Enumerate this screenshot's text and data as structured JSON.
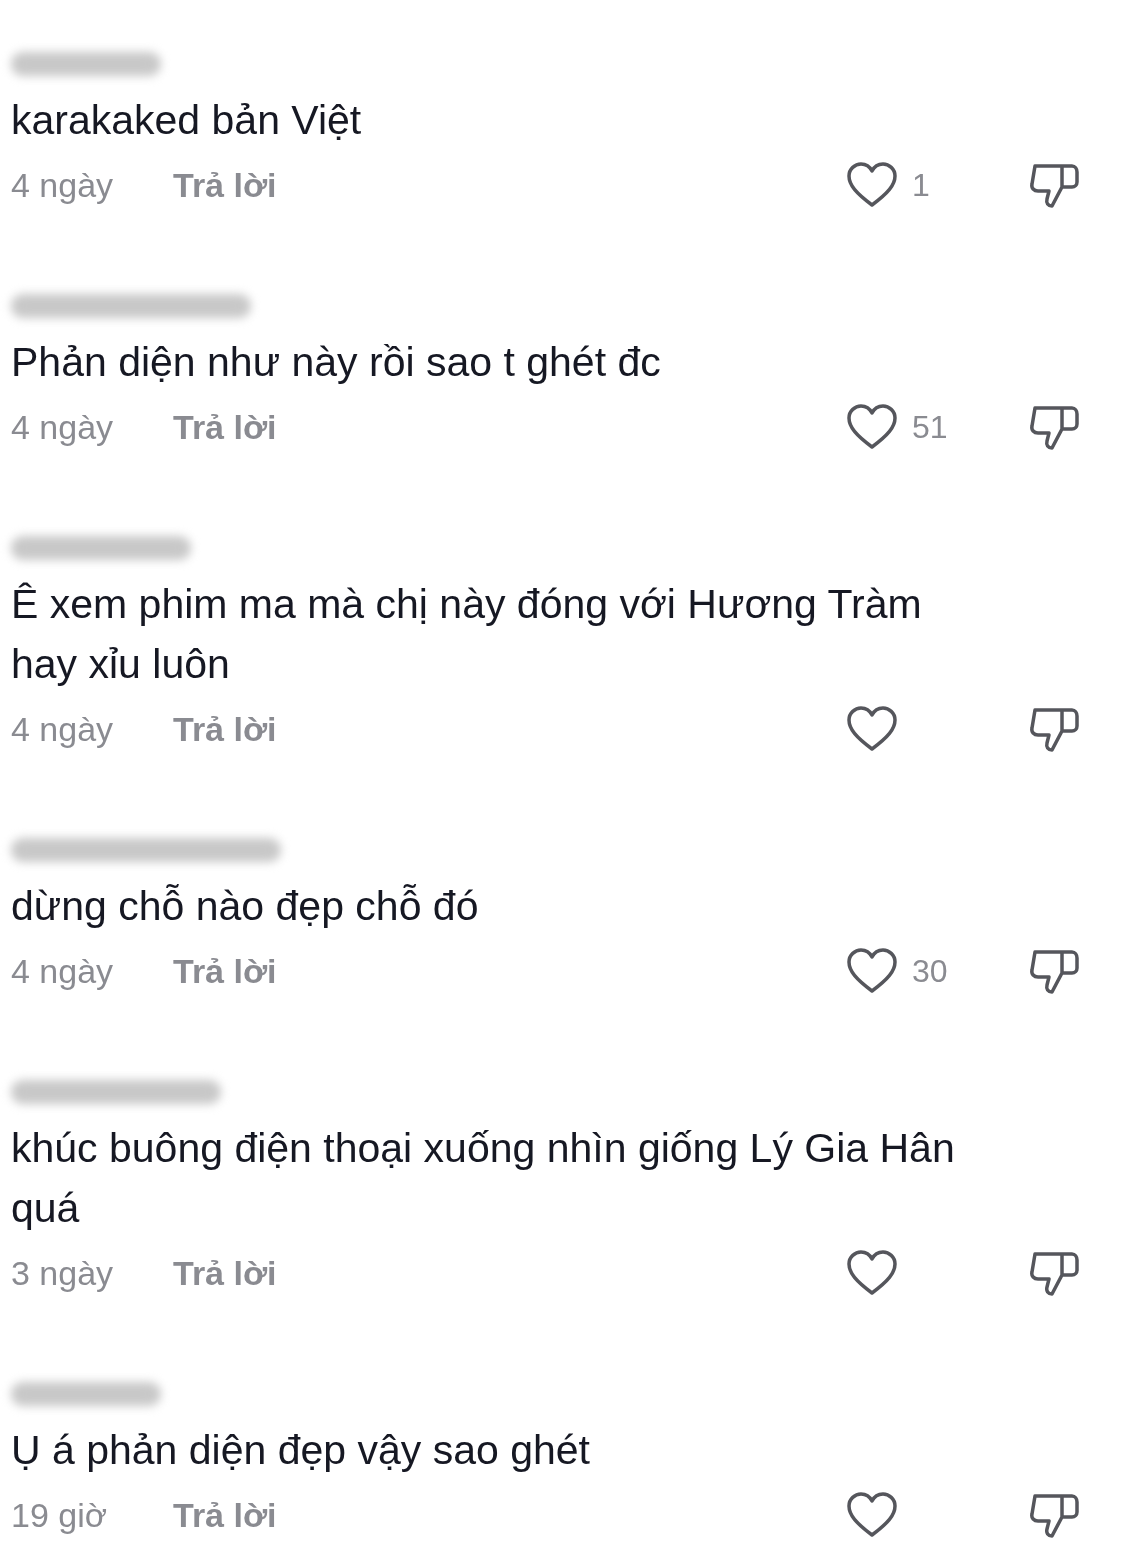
{
  "comments": [
    {
      "author_hidden": true,
      "text": "karakaked bản Việt",
      "time": "4 ngày",
      "reply": "Trả lời",
      "likes": "1"
    },
    {
      "author_hidden": true,
      "text": "Phản diện như này rồi sao t ghét đc",
      "time": "4 ngày",
      "reply": "Trả lời",
      "likes": "51"
    },
    {
      "author_hidden": true,
      "text": "Ê xem phim ma mà chị này đóng với Hương Tràm hay xỉu luôn",
      "time": "4 ngày",
      "reply": "Trả lời"
    },
    {
      "author_hidden": true,
      "text": "dừng chỗ nào đẹp chỗ đó",
      "time": "4 ngày",
      "reply": "Trả lời",
      "likes": "30"
    },
    {
      "author_hidden": true,
      "text": "khúc buông điện thoại xuống nhìn giống Lý Gia Hân quá",
      "time": "3 ngày",
      "reply": "Trả lời"
    },
    {
      "author_hidden": true,
      "text": "Ụ á phản diện đẹp vậy sao ghét",
      "time": "19 giờ",
      "reply": "Trả lời"
    }
  ]
}
